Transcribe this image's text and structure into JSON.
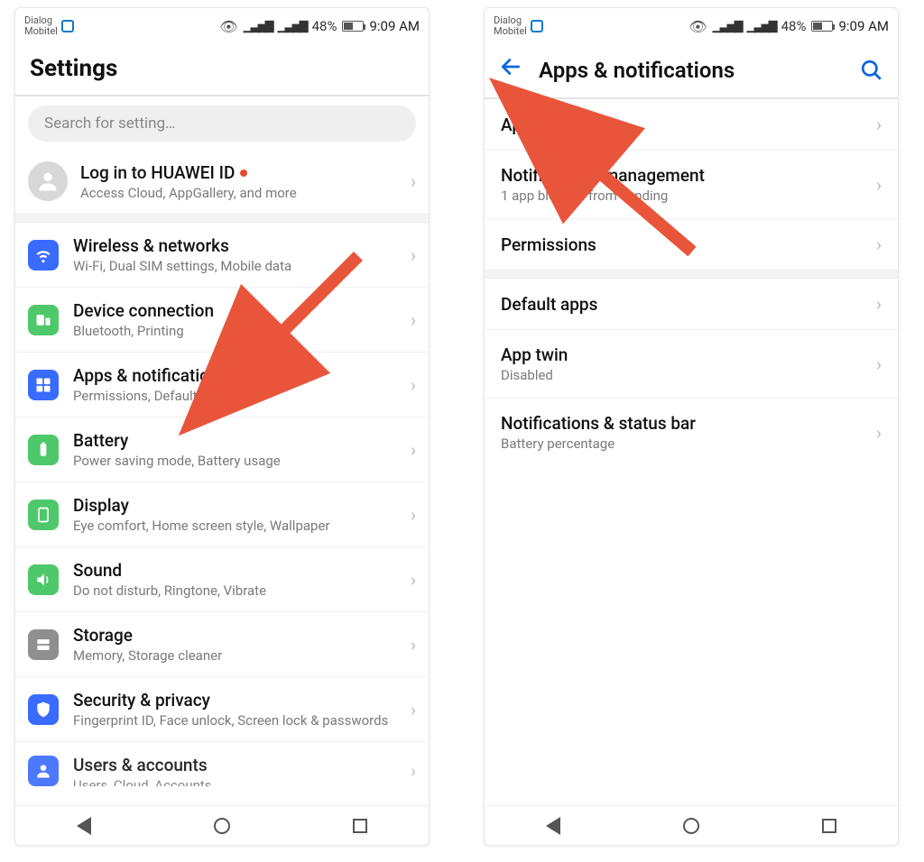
{
  "status": {
    "carrier_line1": "Dialog",
    "carrier_line2": "Mobitel",
    "battery_pct": "48%",
    "time": "9:09 AM"
  },
  "left": {
    "header_title": "Settings",
    "search_placeholder": "Search for setting…",
    "login": {
      "title": "Log in to HUAWEI ID",
      "subtitle": "Access Cloud, AppGallery, and more"
    },
    "items": [
      {
        "icon": "wifi",
        "title": "Wireless & networks",
        "subtitle": "Wi-Fi, Dual SIM settings, Mobile data"
      },
      {
        "icon": "device",
        "title": "Device connection",
        "subtitle": "Bluetooth, Printing"
      },
      {
        "icon": "apps",
        "title": "Apps & notifications",
        "subtitle": "Permissions, Default apps"
      },
      {
        "icon": "battery",
        "title": "Battery",
        "subtitle": "Power saving mode, Battery usage"
      },
      {
        "icon": "display",
        "title": "Display",
        "subtitle": "Eye comfort, Home screen style, Wallpaper"
      },
      {
        "icon": "sound",
        "title": "Sound",
        "subtitle": "Do not disturb, Ringtone, Vibrate"
      },
      {
        "icon": "storage",
        "title": "Storage",
        "subtitle": "Memory, Storage cleaner"
      },
      {
        "icon": "security",
        "title": "Security & privacy",
        "subtitle": "Fingerprint ID, Face unlock, Screen lock & passwords"
      },
      {
        "icon": "users",
        "title": "Users & accounts",
        "subtitle": "Users, Cloud, Accounts"
      }
    ]
  },
  "right": {
    "header_title": "Apps & notifications",
    "group1": [
      {
        "title": "Apps",
        "subtitle": ""
      },
      {
        "title": "Notifications management",
        "subtitle": "1 app blocked from sending"
      },
      {
        "title": "Permissions",
        "subtitle": ""
      }
    ],
    "group2": [
      {
        "title": "Default apps",
        "subtitle": ""
      },
      {
        "title": "App twin",
        "subtitle": "Disabled"
      },
      {
        "title": "Notifications & status bar",
        "subtitle": "Battery percentage"
      }
    ]
  }
}
